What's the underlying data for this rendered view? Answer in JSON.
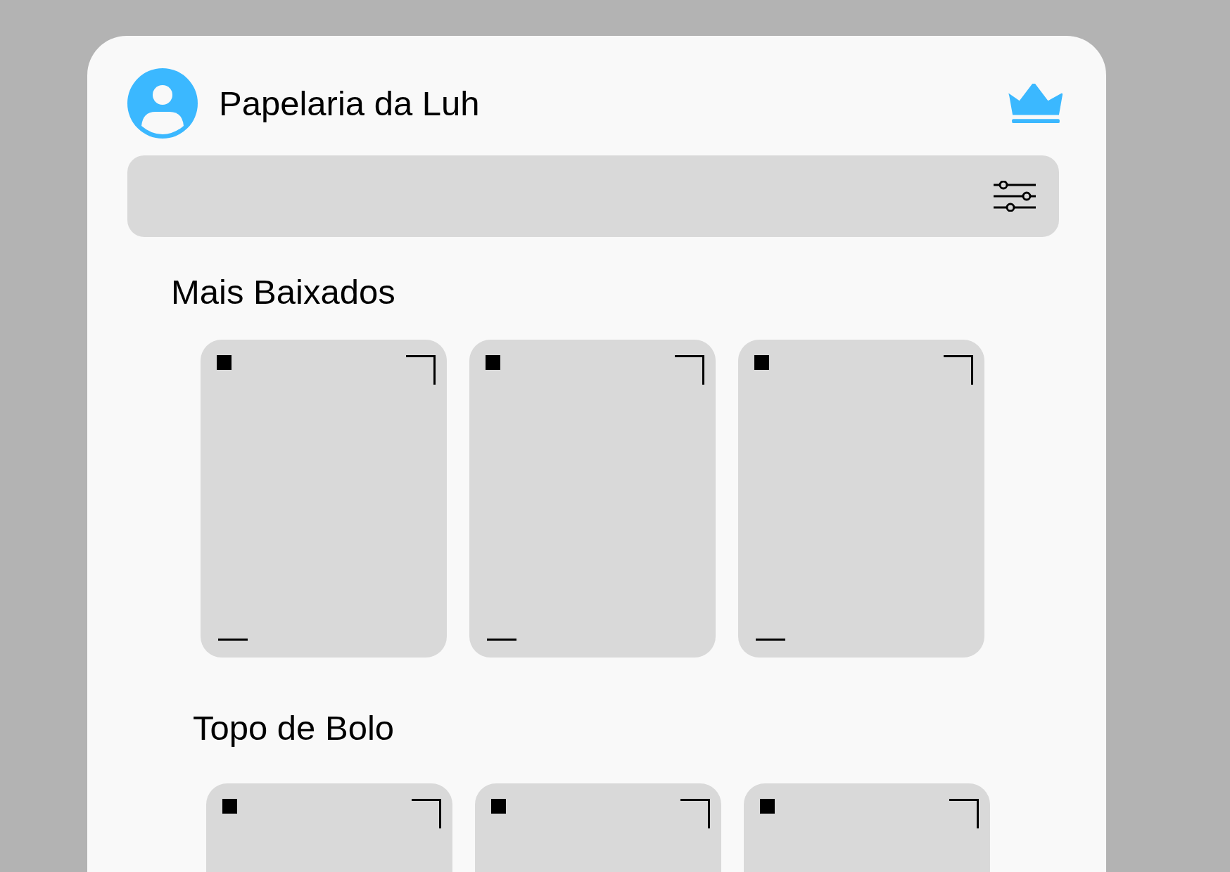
{
  "header": {
    "title": "Papelaria da Luh"
  },
  "sections": [
    {
      "title": "Mais Baixados",
      "cards": [
        {
          "kind": "placeholder"
        },
        {
          "kind": "placeholder"
        },
        {
          "kind": "placeholder"
        }
      ]
    },
    {
      "title": "Topo de Bolo",
      "cards": [
        {
          "kind": "placeholder"
        },
        {
          "kind": "placeholder"
        },
        {
          "kind": "placeholder"
        }
      ]
    }
  ]
}
